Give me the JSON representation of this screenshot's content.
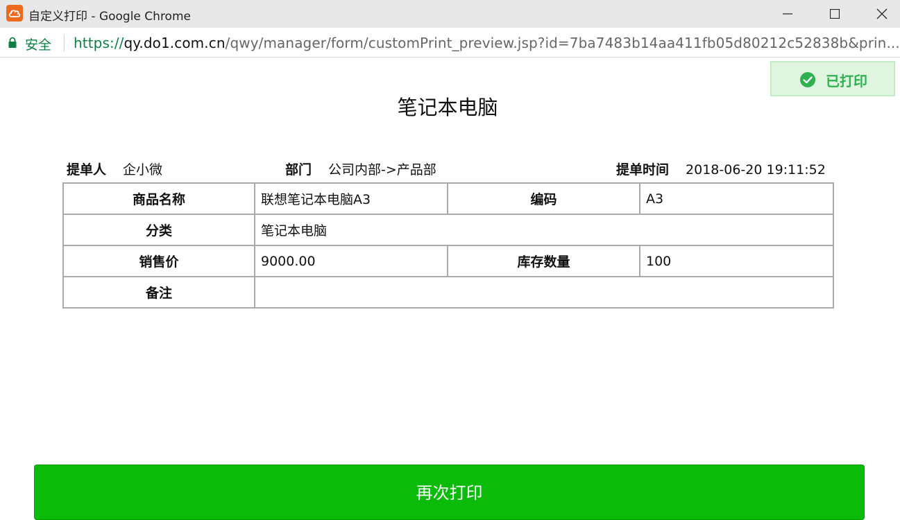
{
  "window": {
    "title": "自定义打印 - Google Chrome"
  },
  "address_bar": {
    "secure_label": "安全",
    "url_scheme": "https://",
    "url_host": "qy.do1.com.cn",
    "url_path": "/qwy/manager/form/customPrint_preview.jsp?id=7ba7483b14aa411fb05d80212c52838b&prin..."
  },
  "status": {
    "printed_label": "已打印"
  },
  "document": {
    "title": "笔记本电脑",
    "meta": {
      "submitter_label": "提单人",
      "submitter_value": "企小微",
      "dept_label": "部门",
      "dept_value": "公司内部->产品部",
      "time_label": "提单时间",
      "time_value": "2018-06-20 19:11:52"
    },
    "table": {
      "product_name_label": "商品名称",
      "product_name_value": "联想笔记本电脑A3",
      "code_label": "编码",
      "code_value": "A3",
      "category_label": "分类",
      "category_value": "笔记本电脑",
      "price_label": "销售价",
      "price_value": "9000.00",
      "stock_label": "库存数量",
      "stock_value": "100",
      "remark_label": "备注",
      "remark_value": ""
    }
  },
  "actions": {
    "reprint_label": "再次打印"
  },
  "colors": {
    "accent_green": "#0abb0a",
    "printed_badge_text": "#2fb14f",
    "secure_green": "#0b8043",
    "app_icon": "#ee6a1c"
  },
  "icons": {
    "app": "cloud-icon",
    "lock": "lock-icon",
    "printed": "check-circle-icon",
    "minimize": "minimize-icon",
    "maximize": "maximize-icon",
    "close": "close-icon"
  }
}
